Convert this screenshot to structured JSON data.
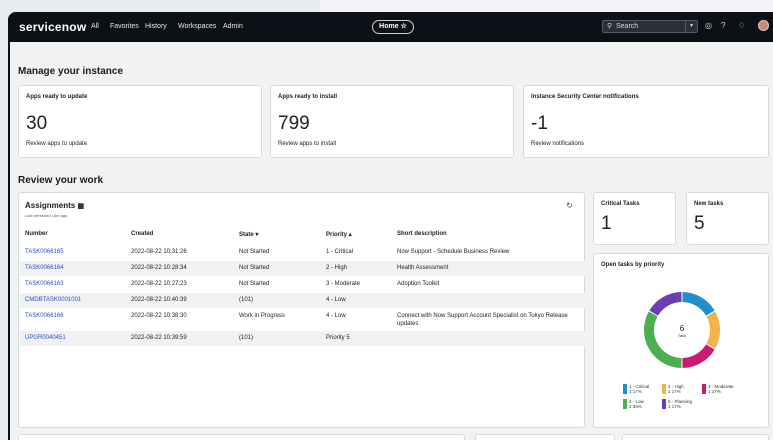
{
  "nav": {
    "logo": "servicenow",
    "menu": [
      "All",
      "Favorites",
      "History",
      "Workspaces",
      "Admin"
    ],
    "home_label": "Home ☆",
    "search_placeholder": "Search"
  },
  "sections": {
    "manage": "Manage your instance",
    "review": "Review your work"
  },
  "cards": [
    {
      "label": "Apps ready to update",
      "value": "30",
      "link": "Review apps to update"
    },
    {
      "label": "Apps ready to install",
      "value": "799",
      "link": "Review apps to install"
    },
    {
      "label": "Instance Security Center notifications",
      "value": "-1",
      "link": "Review notifications"
    }
  ],
  "critical": {
    "label": "Critical Tasks",
    "value": "1"
  },
  "newtasks": {
    "label": "New tasks",
    "value": "5"
  },
  "assignments": {
    "title": "Assignments",
    "subtitle": "Last refreshed 14m ago.",
    "headers": [
      "Number",
      "Created",
      "State ▾",
      "Priority ▴",
      "Short description"
    ],
    "rows": [
      {
        "number": "TASK0066165",
        "created": "2022-08-22 10:31:26",
        "state": "Not Started",
        "priority": "1 - Critical",
        "desc": "Now Support - Schedule Business Review",
        "desc2": ""
      },
      {
        "number": "TASK0066164",
        "created": "2022-08-22 10:28:34",
        "state": "Not Started",
        "priority": "2 - High",
        "desc": "Health Assessment",
        "desc2": ""
      },
      {
        "number": "TASK0066163",
        "created": "2022-08-22 10:27:23",
        "state": "Not Started",
        "priority": "3 - Moderate",
        "desc": "Adoption Toolkit",
        "desc2": ""
      },
      {
        "number": "CMDBTASK0001001",
        "created": "2022-08-22 10:40:39",
        "state": "(101)",
        "priority": "4 - Low",
        "desc": "",
        "desc2": ""
      },
      {
        "number": "TASK0066166",
        "created": "2022-08-22 10:38:30",
        "state": "Work in Progress",
        "priority": "4 - Low",
        "desc": "Connect with Now Support Account Specialist on Tokyo Release",
        "desc2": "updates"
      },
      {
        "number": "UPGR0040451",
        "created": "2022-08-22 10:39:59",
        "state": "(101)",
        "priority": "Priority 5",
        "desc": "",
        "desc2": ""
      }
    ]
  },
  "donut": {
    "title": "Open tasks by priority",
    "center_value": "6",
    "center_label": "Task"
  },
  "chart_data": {
    "type": "pie",
    "title": "Open tasks by priority",
    "series": [
      {
        "name": "1 - Critical",
        "count": "1",
        "pct": "17%",
        "value": 1,
        "color": "#1e8fc7"
      },
      {
        "name": "2 - High",
        "count": "1",
        "pct": "17%",
        "value": 1,
        "color": "#f4b24a"
      },
      {
        "name": "3 - Moderate",
        "count": "1",
        "pct": "17%",
        "value": 1,
        "color": "#cc1a73"
      },
      {
        "name": "4 - Low",
        "count": "2",
        "pct": "33%",
        "value": 2,
        "color": "#4caf50"
      },
      {
        "name": "5 - Planning",
        "count": "1",
        "pct": "17%",
        "value": 1,
        "color": "#6a3fb0"
      }
    ]
  }
}
